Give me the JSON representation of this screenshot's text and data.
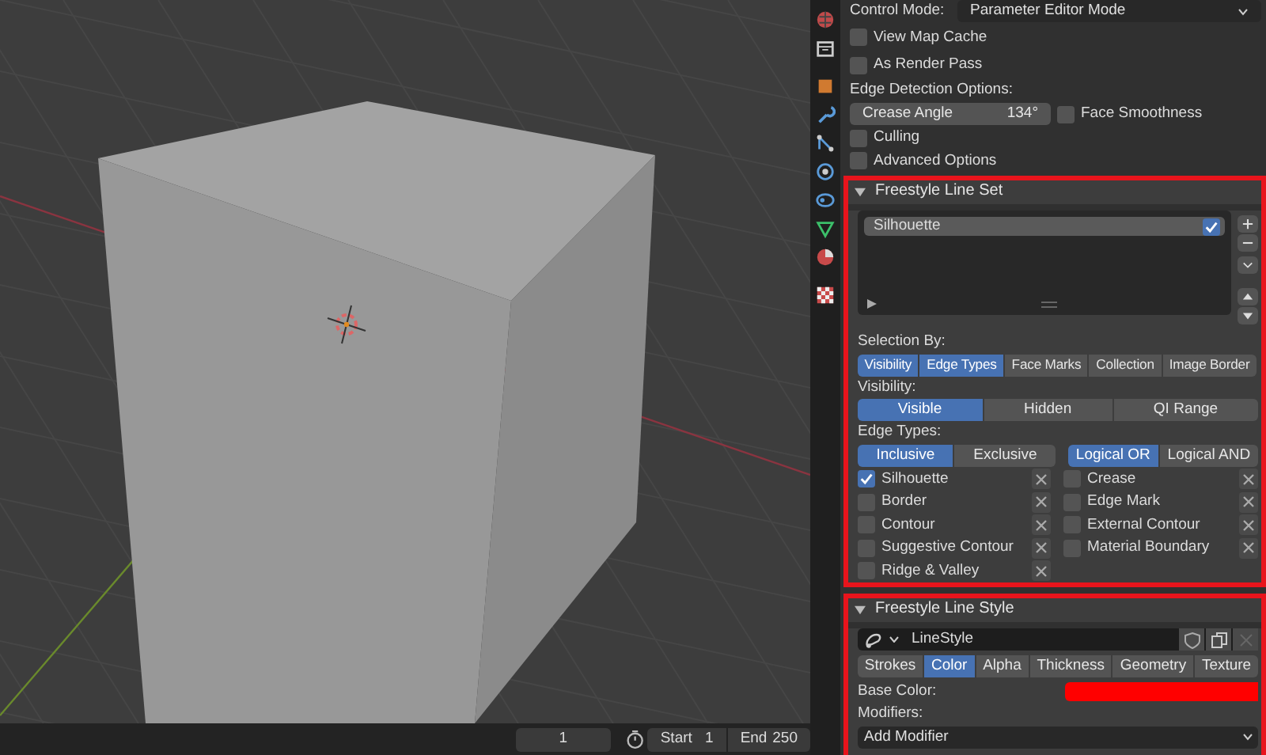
{
  "properties": {
    "control_mode": {
      "label": "Control Mode:",
      "value": "Parameter Editor Mode"
    },
    "options": [
      {
        "label": "View Map Cache",
        "checked": false
      },
      {
        "label": "As Render Pass",
        "checked": false
      }
    ],
    "edge_detection": {
      "label": "Edge Detection Options:",
      "crease_angle": {
        "label": "Crease Angle",
        "value": "134°"
      },
      "face_smoothness": {
        "label": "Face Smoothness",
        "checked": false
      },
      "options": [
        {
          "label": "Culling",
          "checked": false
        },
        {
          "label": "Advanced Options",
          "checked": false
        }
      ]
    }
  },
  "line_set": {
    "title": "Freestyle Line Set",
    "expanded": true,
    "items": [
      {
        "name": "Silhouette",
        "checked": true,
        "selected": true
      }
    ],
    "selection_by": {
      "label": "Selection By:",
      "options": [
        {
          "label": "Visibility",
          "selected": true
        },
        {
          "label": "Edge Types",
          "selected": true
        },
        {
          "label": "Face Marks",
          "selected": false
        },
        {
          "label": "Collection",
          "selected": false
        },
        {
          "label": "Image Border",
          "selected": false
        }
      ]
    },
    "visibility": {
      "label": "Visibility:",
      "options": [
        {
          "label": "Visible",
          "selected": true
        },
        {
          "label": "Hidden",
          "selected": false
        },
        {
          "label": "QI Range",
          "selected": false
        }
      ]
    },
    "edge_types": {
      "label": "Edge Types:",
      "mode": [
        {
          "label": "Inclusive",
          "selected": true
        },
        {
          "label": "Exclusive",
          "selected": false
        }
      ],
      "logic": [
        {
          "label": "Logical OR",
          "selected": true
        },
        {
          "label": "Logical AND",
          "selected": false
        }
      ],
      "left": [
        {
          "label": "Silhouette",
          "checked": true
        },
        {
          "label": "Border",
          "checked": false
        },
        {
          "label": "Contour",
          "checked": false
        },
        {
          "label": "Suggestive Contour",
          "checked": false
        },
        {
          "label": "Ridge & Valley",
          "checked": false
        }
      ],
      "right": [
        {
          "label": "Crease",
          "checked": false
        },
        {
          "label": "Edge Mark",
          "checked": false
        },
        {
          "label": "External Contour",
          "checked": false
        },
        {
          "label": "Material Boundary",
          "checked": false
        }
      ]
    }
  },
  "line_style": {
    "title": "Freestyle Line Style",
    "expanded": true,
    "name": "LineStyle",
    "tabs": [
      {
        "label": "Strokes",
        "selected": false
      },
      {
        "label": "Color",
        "selected": true
      },
      {
        "label": "Alpha",
        "selected": false
      },
      {
        "label": "Thickness",
        "selected": false
      },
      {
        "label": "Geometry",
        "selected": false
      },
      {
        "label": "Texture",
        "selected": false
      }
    ],
    "base_color": {
      "label": "Base Color:",
      "color": "#ff0000"
    },
    "modifiers_label": "Modifiers:",
    "add_modifier": "Add Modifier"
  },
  "timeline": {
    "current_frame": "1",
    "start": {
      "label": "Start",
      "value": "1"
    },
    "end": {
      "label": "End",
      "value": "250"
    }
  }
}
